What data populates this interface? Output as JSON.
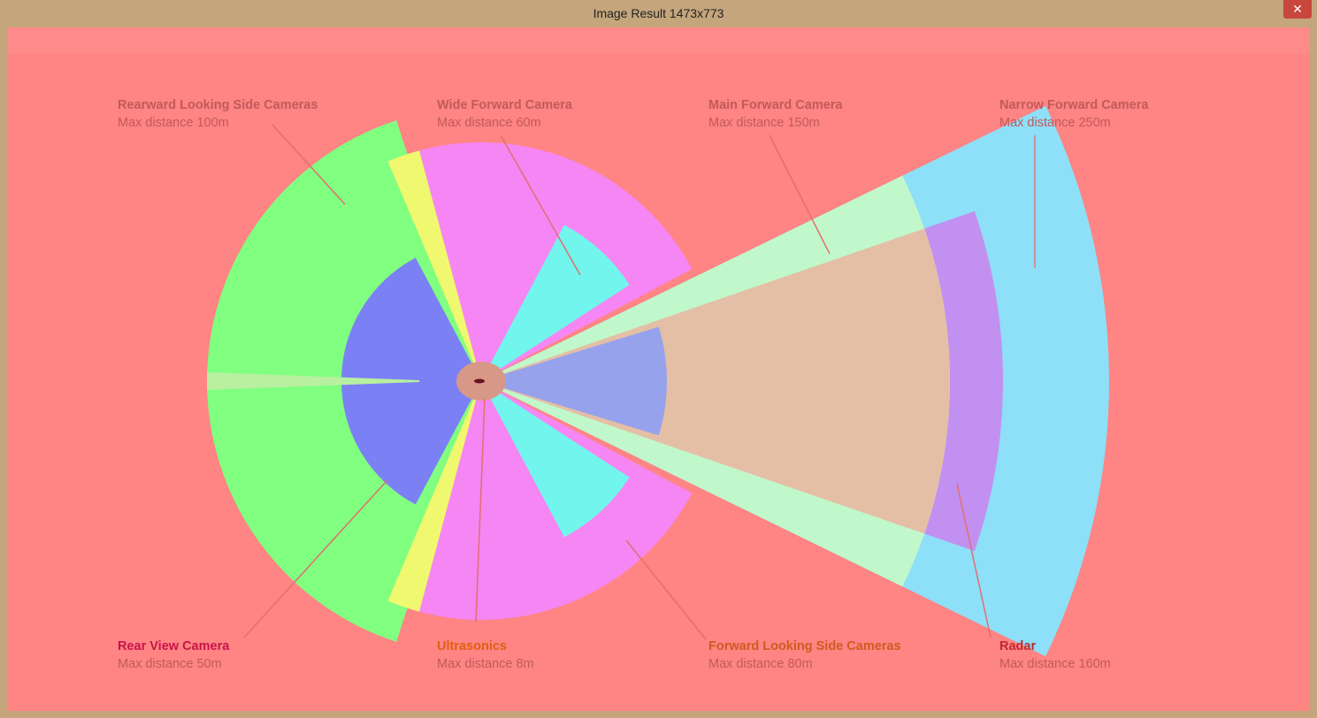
{
  "window": {
    "title": "Image Result 1473x773",
    "close_label": "✕"
  },
  "colors": {
    "background": "#ff8484",
    "rearward_side": "#80ff80",
    "wide_forward": "#f686f3",
    "main_forward": "#c0f8cc",
    "narrow_forward": "#8edff8",
    "rear_view": "#7b80f5",
    "ultrasonics": "#f0f870",
    "forward_side": "#72f5ec",
    "radar": "#c290f0"
  },
  "labels": [
    {
      "id": "rearward-side",
      "name": "Rearward Looking Side Cameras",
      "distance": "Max distance 100m",
      "name_color": "#c25a5a",
      "dist_color": "#c25a5a"
    },
    {
      "id": "wide-forward",
      "name": "Wide Forward Camera",
      "distance": "Max distance 60m",
      "name_color": "#c25a5a",
      "dist_color": "#c25a5a"
    },
    {
      "id": "main-forward",
      "name": "Main Forward Camera",
      "distance": "Max distance 150m",
      "name_color": "#c25a5a",
      "dist_color": "#c25a5a"
    },
    {
      "id": "narrow-forward",
      "name": "Narrow Forward Camera",
      "distance": "Max distance 250m",
      "name_color": "#c25a5a",
      "dist_color": "#c25a5a"
    },
    {
      "id": "rear-view",
      "name": "Rear View Camera",
      "distance": "Max distance 50m",
      "name_color": "#c8144a",
      "dist_color": "#c25a5a"
    },
    {
      "id": "ultrasonics",
      "name": "Ultrasonics",
      "distance": "Max distance 8m",
      "name_color": "#e06010",
      "dist_color": "#c25a5a"
    },
    {
      "id": "forward-side",
      "name": "Forward Looking Side Cameras",
      "distance": "Max distance 80m",
      "name_color": "#d05a20",
      "dist_color": "#c25a5a"
    },
    {
      "id": "radar",
      "name": "Radar",
      "distance": "Max distance 160m",
      "name_color": "#c02830",
      "dist_color": "#c25a5a"
    }
  ]
}
